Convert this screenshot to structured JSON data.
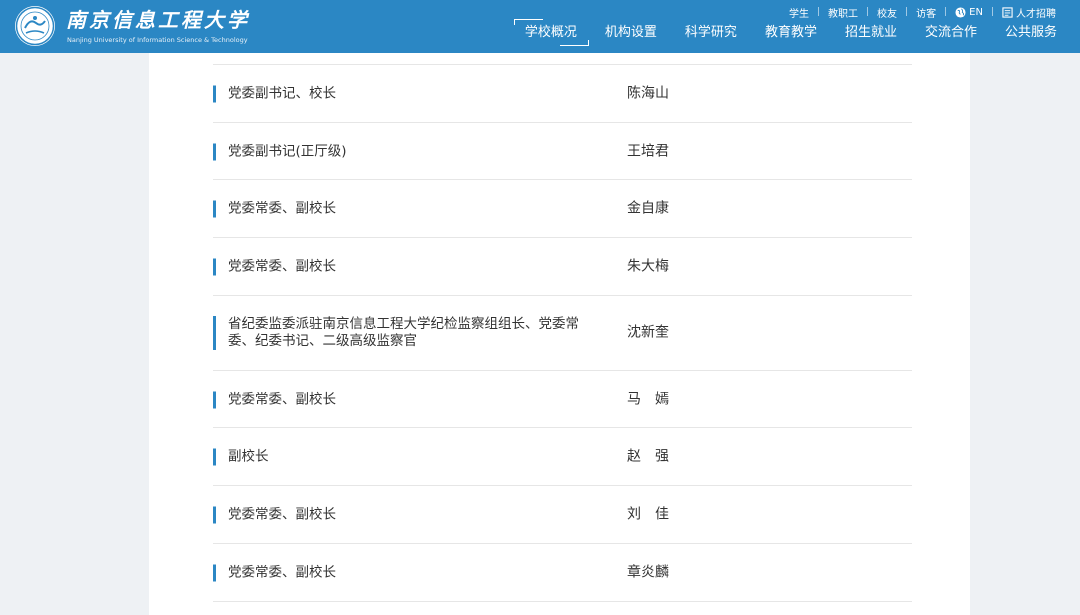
{
  "header": {
    "logo_cn": "南京信息工程大学",
    "logo_en": "Nanjing University of Information Science & Technology",
    "top_links": [
      "学生",
      "教职工",
      "校友",
      "访客",
      "EN",
      "人才招聘"
    ],
    "nav": [
      "学校概况",
      "机构设置",
      "科学研究",
      "教育教学",
      "招生就业",
      "交流合作",
      "公共服务"
    ],
    "active_nav": "学校概况"
  },
  "leaders": [
    {
      "position": "党委副书记、校长",
      "name": "陈海山"
    },
    {
      "position": "党委副书记(正厅级)",
      "name": "王培君"
    },
    {
      "position": "党委常委、副校长",
      "name": "金自康"
    },
    {
      "position": "党委常委、副校长",
      "name": "朱大梅"
    },
    {
      "position": "省纪委监委派驻南京信息工程大学纪检监察组组长、党委常委、纪委书记、二级高级监察官",
      "name": "沈新奎"
    },
    {
      "position": "党委常委、副校长",
      "name": "马　嫣"
    },
    {
      "position": "副校长",
      "name": "赵　强"
    },
    {
      "position": "党委常委、副校长",
      "name": "刘　佳"
    },
    {
      "position": "党委常委、副校长",
      "name": "章炎麟"
    }
  ],
  "colors": {
    "brand": "#2b87c4",
    "background": "#eef1f4",
    "text": "#333333",
    "divider": "#e6e6e6"
  }
}
